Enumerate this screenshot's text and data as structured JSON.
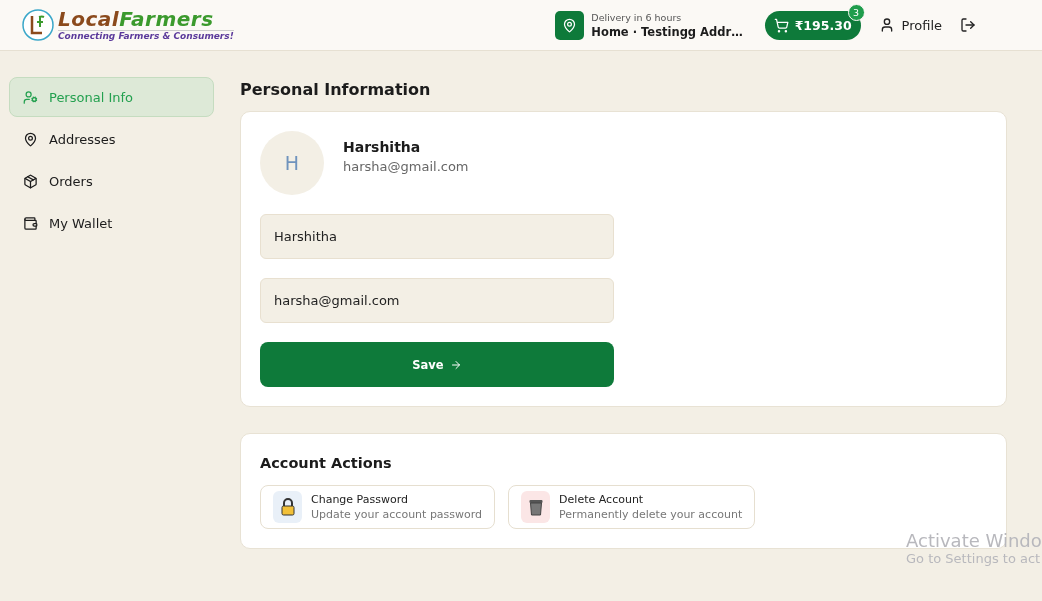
{
  "header": {
    "logo": {
      "word_1": "Local",
      "word_2": "Farmers",
      "tagline": "Connecting Farmers & Consumers!"
    },
    "delivery": {
      "label": "Delivery in 6 hours",
      "address": "Home · Testingg Addr…"
    },
    "cart": {
      "total": "₹195.30",
      "count": "3"
    },
    "profile": "Profile"
  },
  "sidebar": {
    "items": [
      {
        "label": "Personal Info",
        "selected": true
      },
      {
        "label": "Addresses",
        "selected": false
      },
      {
        "label": "Orders",
        "selected": false
      },
      {
        "label": "My Wallet",
        "selected": false
      }
    ]
  },
  "page_title": "Personal Information",
  "profile_card": {
    "initial": "H",
    "name": "Harshitha",
    "email": "harsha@gmail.com",
    "fields": [
      {
        "value": "Harshitha"
      },
      {
        "value": "harsha@gmail.com"
      }
    ],
    "save": "Save"
  },
  "account_actions": {
    "title": "Account Actions",
    "actions": [
      {
        "kind": "password",
        "title": "Change Password",
        "subtitle": "Update your account password"
      },
      {
        "kind": "delete",
        "title": "Delete Account",
        "subtitle": "Permanently delete your account"
      }
    ]
  },
  "os_notice": {
    "title": "Activate Windo",
    "subtitle": "Go to Settings to act"
  }
}
